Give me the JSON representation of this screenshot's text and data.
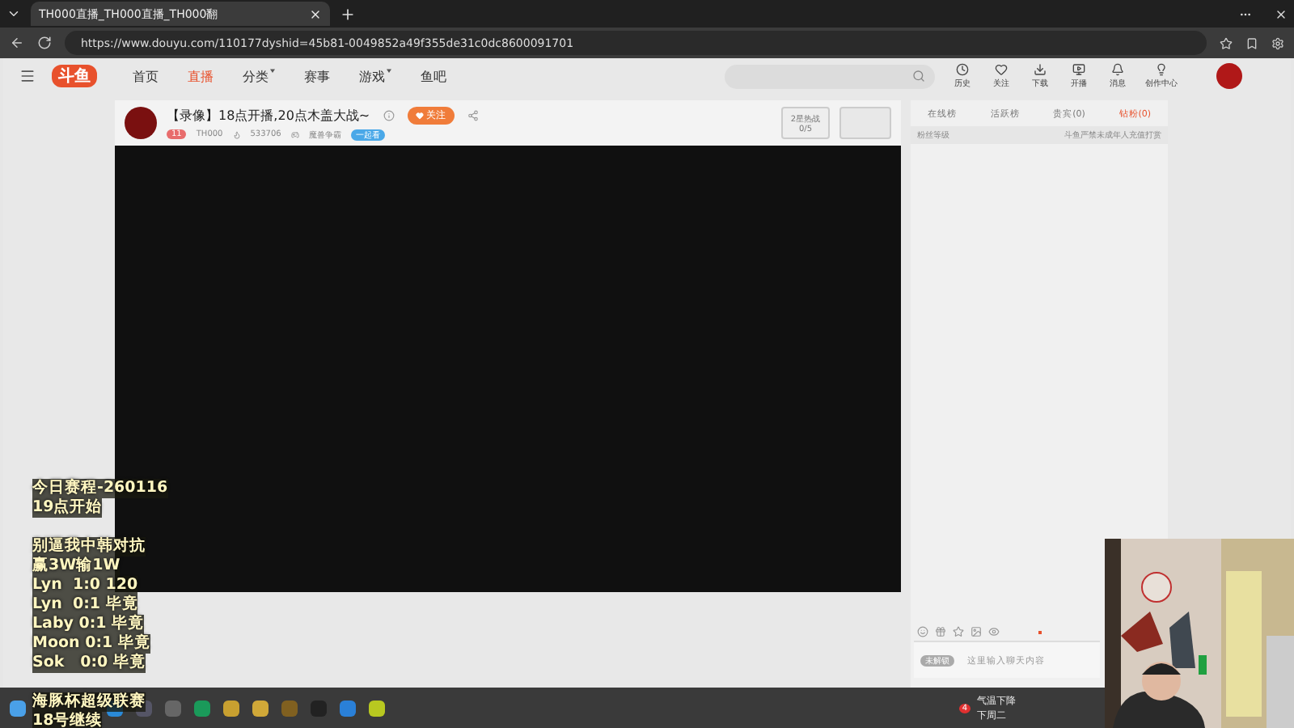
{
  "browser": {
    "tab_title": "TH000直播_TH000直播_TH000翻",
    "url": "https://www.douyu.com/110177dyshid=45b81-0049852a49f355de31c0dc8600091701"
  },
  "nav": {
    "logo": "斗鱼",
    "items": [
      {
        "label": "首页",
        "selected": false,
        "dropdown": false
      },
      {
        "label": "直播",
        "selected": true,
        "dropdown": false
      },
      {
        "label": "分类",
        "selected": false,
        "dropdown": true
      },
      {
        "label": "赛事",
        "selected": false,
        "dropdown": false
      },
      {
        "label": "游戏",
        "selected": false,
        "dropdown": true
      },
      {
        "label": "鱼吧",
        "selected": false,
        "dropdown": false
      }
    ],
    "actions": [
      {
        "kind": "history",
        "label": "历史"
      },
      {
        "kind": "follow",
        "label": "关注"
      },
      {
        "kind": "download",
        "label": "下载"
      },
      {
        "kind": "broadcast",
        "label": "开播"
      },
      {
        "kind": "message",
        "label": "消息"
      },
      {
        "kind": "creator",
        "label": "创作中心"
      }
    ]
  },
  "room": {
    "title": "【录像】18点开播,20点木盖大战~",
    "follow": "关注",
    "level": "11",
    "host": "TH000",
    "viewers": "533706",
    "category": "魔兽争霸",
    "tag": "一起看",
    "hot_title": "2星热战",
    "hot_value": "0/5"
  },
  "side": {
    "tabs": [
      {
        "label": "在线榜",
        "selected": false
      },
      {
        "label": "活跃榜",
        "selected": false
      },
      {
        "label": "贵宾(0)",
        "selected": false
      },
      {
        "label": "钻粉(0)",
        "selected": true
      }
    ],
    "fan_label": "粉丝等级",
    "notice": "斗鱼严禁未成年人充值打赏",
    "chat_placeholder": "这里输入聊天内容",
    "chat_badge": "未解锁"
  },
  "overlay": {
    "blocks": [
      [
        "今日赛程-260116",
        "19点开始"
      ],
      [
        "别逼我中韩对抗",
        "赢3W输1W",
        "Lyn  1:0 120",
        "Lyn  0:1 毕竟",
        "Laby 0:1 毕竟",
        "Moon 0:1 毕竟",
        "Sok   0:0 毕竟"
      ],
      [
        "海豚杯超级联赛",
        "18号继续"
      ]
    ]
  },
  "taskbar": {
    "weather": "气温下降",
    "weather_sub": "下周二",
    "weather_badge": "4"
  }
}
